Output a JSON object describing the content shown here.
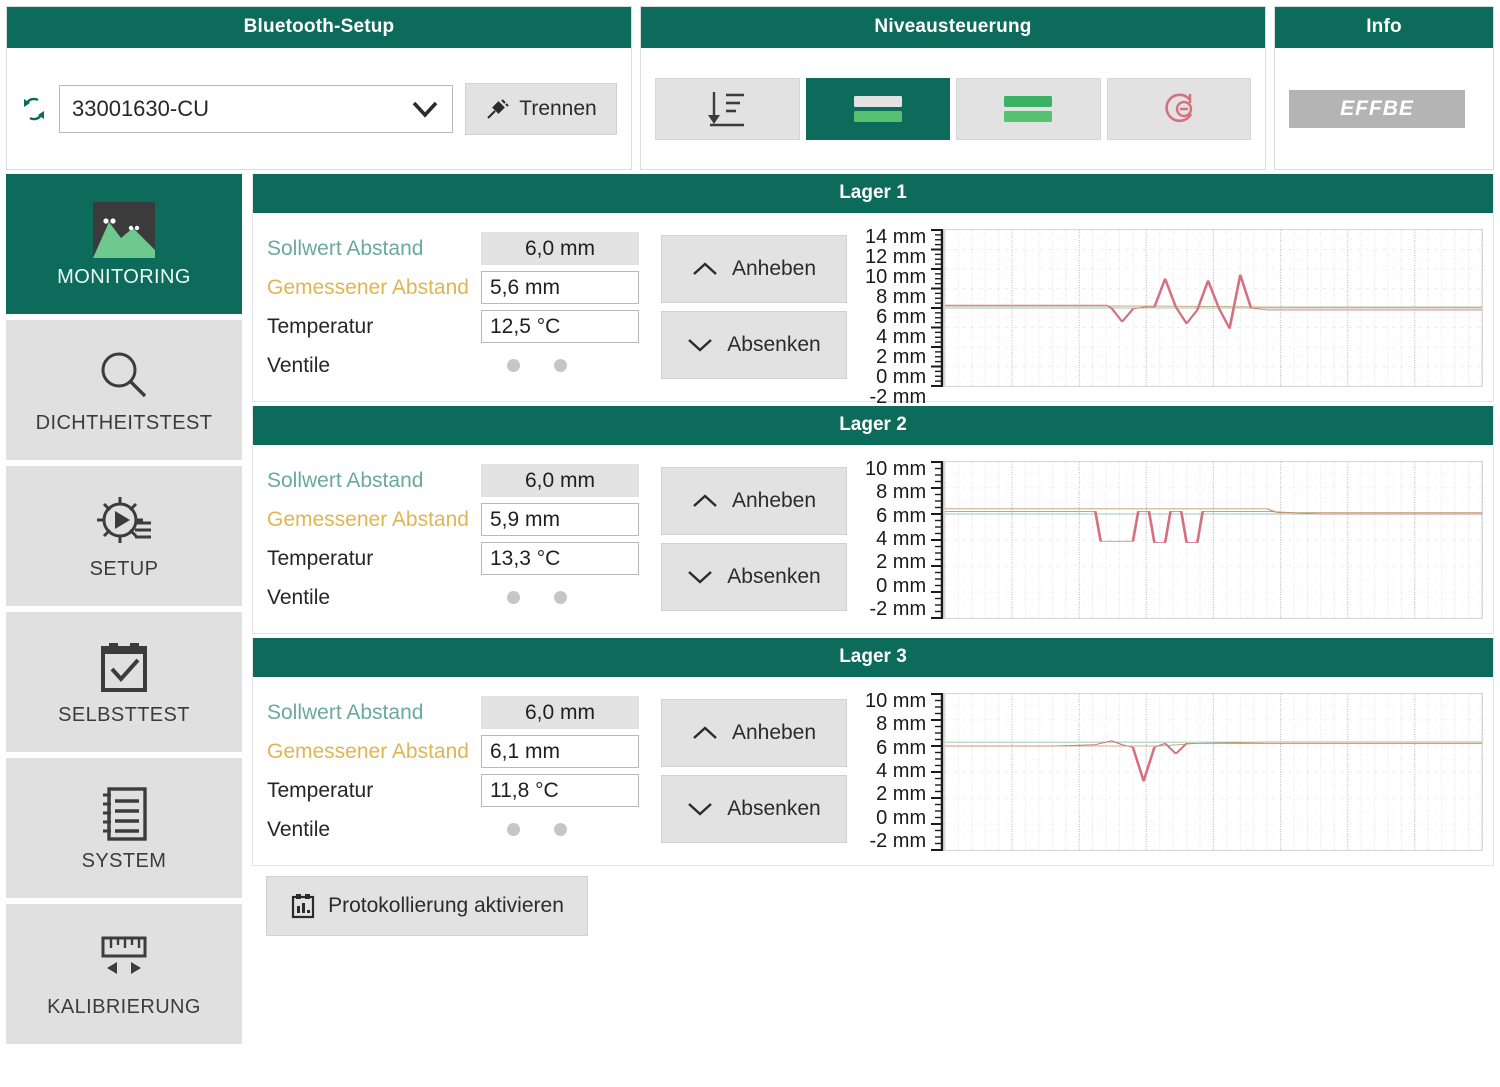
{
  "header": {
    "bluetooth": {
      "title": "Bluetooth-Setup",
      "refresh_icon": "refresh-icon",
      "device_value": "33001630-CU",
      "device_placeholder": "33001630-CU",
      "dropdown_icon": "chevron-down-icon",
      "disconnect_label": "Trennen",
      "disconnect_icon": "plug-disconnect-icon"
    },
    "niveau": {
      "title": "Niveausteuerung",
      "buttons": [
        {
          "name": "lower-all-button",
          "icon": "align-bottom-icon",
          "active": false
        },
        {
          "name": "level-single-button",
          "icon": "two-bars-icon",
          "active": true
        },
        {
          "name": "level-double-button",
          "icon": "two-green-bars-icon",
          "active": false
        },
        {
          "name": "stop-button",
          "icon": "cancel-circle-icon",
          "active": false
        }
      ]
    },
    "info": {
      "title": "Info",
      "logo_text": "EFFBE",
      "logo_color": "#b4b4b4"
    }
  },
  "sidebar": {
    "items": [
      {
        "label": "MONITORING",
        "icon": "chart-mountain-icon",
        "active": true
      },
      {
        "label": "DICHTHEITSTEST",
        "icon": "magnifier-icon",
        "active": false
      },
      {
        "label": "SETUP",
        "icon": "gear-play-icon",
        "active": false
      },
      {
        "label": "SELBSTTEST",
        "icon": "checkbox-clip-icon",
        "active": false
      },
      {
        "label": "SYSTEM",
        "icon": "notebook-icon",
        "active": false
      },
      {
        "label": "KALIBRIERUNG",
        "icon": "ruler-arrows-icon",
        "active": false
      }
    ]
  },
  "labels": {
    "sollwert": "Sollwert Abstand",
    "gemessen": "Gemessener Abstand",
    "temperatur": "Temperatur",
    "ventile": "Ventile",
    "anheben": "Anheben",
    "absenken": "Absenken"
  },
  "colors": {
    "brand_green": "#0c6b5b",
    "sollwert_text": "#6aa99b",
    "gemessen_text": "#e0b552",
    "trace_red": "#d4707f",
    "trace_green": "#7fb89f",
    "trace_tan": "#c09a6a",
    "button_grey": "#e2e2e2"
  },
  "lagers": [
    {
      "title": "Lager 1",
      "sollwert": "6,0 mm",
      "gemessen": "5,6 mm",
      "temperatur": "12,5 °C",
      "ventile": [
        "off",
        "off"
      ]
    },
    {
      "title": "Lager 2",
      "sollwert": "6,0 mm",
      "gemessen": "5,9 mm",
      "temperatur": "13,3 °C",
      "ventile": [
        "off",
        "off"
      ]
    },
    {
      "title": "Lager 3",
      "sollwert": "6,0 mm",
      "gemessen": "6,1 mm",
      "temperatur": "11,8 °C",
      "ventile": [
        "off",
        "off"
      ]
    }
  ],
  "footer": {
    "protokoll_label": "Protokollierung aktivieren",
    "protokoll_icon": "chart-clipboard-icon"
  },
  "chart_data": [
    {
      "type": "line",
      "title": "Lager 1",
      "ylabel": "mm",
      "ylim": [
        -2,
        14
      ],
      "yticks": [
        14,
        12,
        10,
        8,
        6,
        4,
        2,
        0,
        -2
      ],
      "ytick_labels": [
        "14 mm",
        "12 mm",
        "10 mm",
        "8 mm",
        "6 mm",
        "4 mm",
        "2 mm",
        "0 mm",
        "-2 mm"
      ],
      "grid": true,
      "legend": "none",
      "series": [
        {
          "name": "sollwert",
          "color": "#7fb89f",
          "x": [
            0,
            10,
            20,
            30,
            40,
            50,
            60,
            70,
            80,
            90,
            100
          ],
          "values": [
            6.0,
            6.0,
            6.0,
            6.0,
            6.0,
            6.0,
            6.0,
            6.0,
            6.0,
            6.0,
            6.0
          ]
        },
        {
          "name": "gemessen",
          "color": "#d4707f",
          "x": [
            0,
            5,
            10,
            15,
            20,
            25,
            30,
            31,
            33,
            35,
            37,
            39,
            41,
            43,
            45,
            47,
            49,
            51,
            53,
            55,
            57,
            60,
            65,
            70,
            75,
            80,
            85,
            90,
            95,
            100
          ],
          "values": [
            6.3,
            6.3,
            6.3,
            6.3,
            6.3,
            6.3,
            6.3,
            6.0,
            4.6,
            5.9,
            6.1,
            6.1,
            9.0,
            6.1,
            4.4,
            5.8,
            8.8,
            6.0,
            3.9,
            9.4,
            6.0,
            5.8,
            5.8,
            5.8,
            5.8,
            5.8,
            5.8,
            5.8,
            5.8,
            5.8
          ]
        },
        {
          "name": "referenz",
          "color": "#c09a6a",
          "x": [
            0,
            20,
            40,
            60,
            80,
            100
          ],
          "values": [
            6.2,
            6.2,
            6.2,
            6.1,
            6.1,
            6.1
          ]
        }
      ]
    },
    {
      "type": "line",
      "title": "Lager 2",
      "ylabel": "mm",
      "ylim": [
        -2,
        10
      ],
      "yticks": [
        10,
        8,
        6,
        4,
        2,
        0,
        -2
      ],
      "ytick_labels": [
        "10 mm",
        "8 mm",
        "6 mm",
        "4 mm",
        "2 mm",
        "0 mm",
        "-2 mm"
      ],
      "grid": true,
      "legend": "none",
      "series": [
        {
          "name": "sollwert",
          "color": "#7fb89f",
          "x": [
            0,
            20,
            40,
            60,
            80,
            100
          ],
          "values": [
            6.0,
            6.0,
            6.0,
            6.0,
            6.0,
            6.0
          ]
        },
        {
          "name": "gemessen",
          "color": "#d4707f",
          "x": [
            0,
            10,
            20,
            28,
            29,
            31,
            35,
            36,
            38,
            39,
            41,
            42,
            44,
            45,
            47,
            48,
            50,
            60,
            70,
            80,
            90,
            100
          ],
          "values": [
            6.2,
            6.2,
            6.2,
            6.2,
            3.9,
            3.9,
            3.9,
            6.2,
            6.2,
            3.8,
            3.8,
            6.2,
            6.2,
            3.8,
            3.8,
            6.2,
            6.2,
            6.2,
            6.0,
            6.0,
            6.0,
            6.0
          ]
        },
        {
          "name": "referenz",
          "color": "#c09a6a",
          "x": [
            0,
            20,
            40,
            60,
            62,
            80,
            100
          ],
          "values": [
            6.4,
            6.4,
            6.4,
            6.4,
            6.1,
            6.1,
            6.1
          ]
        }
      ]
    },
    {
      "type": "line",
      "title": "Lager 3",
      "ylabel": "mm",
      "ylim": [
        -2,
        10
      ],
      "yticks": [
        10,
        8,
        6,
        4,
        2,
        0,
        -2
      ],
      "ytick_labels": [
        "10 mm",
        "8 mm",
        "6 mm",
        "4 mm",
        "2 mm",
        "0 mm",
        "-2 mm"
      ],
      "grid": true,
      "legend": "none",
      "series": [
        {
          "name": "sollwert",
          "color": "#7fb89f",
          "x": [
            0,
            20,
            40,
            60,
            80,
            100
          ],
          "values": [
            6.3,
            6.3,
            6.3,
            6.3,
            6.3,
            6.3
          ]
        },
        {
          "name": "gemessen",
          "color": "#d4707f",
          "x": [
            0,
            10,
            20,
            28,
            31,
            33,
            35,
            37,
            39,
            41,
            43,
            45,
            47,
            50,
            60,
            70,
            80,
            90,
            100
          ],
          "values": [
            6.0,
            6.0,
            6.0,
            6.1,
            6.4,
            6.1,
            5.9,
            3.3,
            5.9,
            6.2,
            5.4,
            6.2,
            6.2,
            6.2,
            6.2,
            6.2,
            6.2,
            6.2,
            6.2
          ]
        },
        {
          "name": "referenz",
          "color": "#c09a6a",
          "x": [
            0,
            20,
            40,
            47,
            60,
            80,
            100
          ],
          "values": [
            6.0,
            6.0,
            6.0,
            6.2,
            6.3,
            6.3,
            6.3
          ]
        }
      ]
    }
  ]
}
